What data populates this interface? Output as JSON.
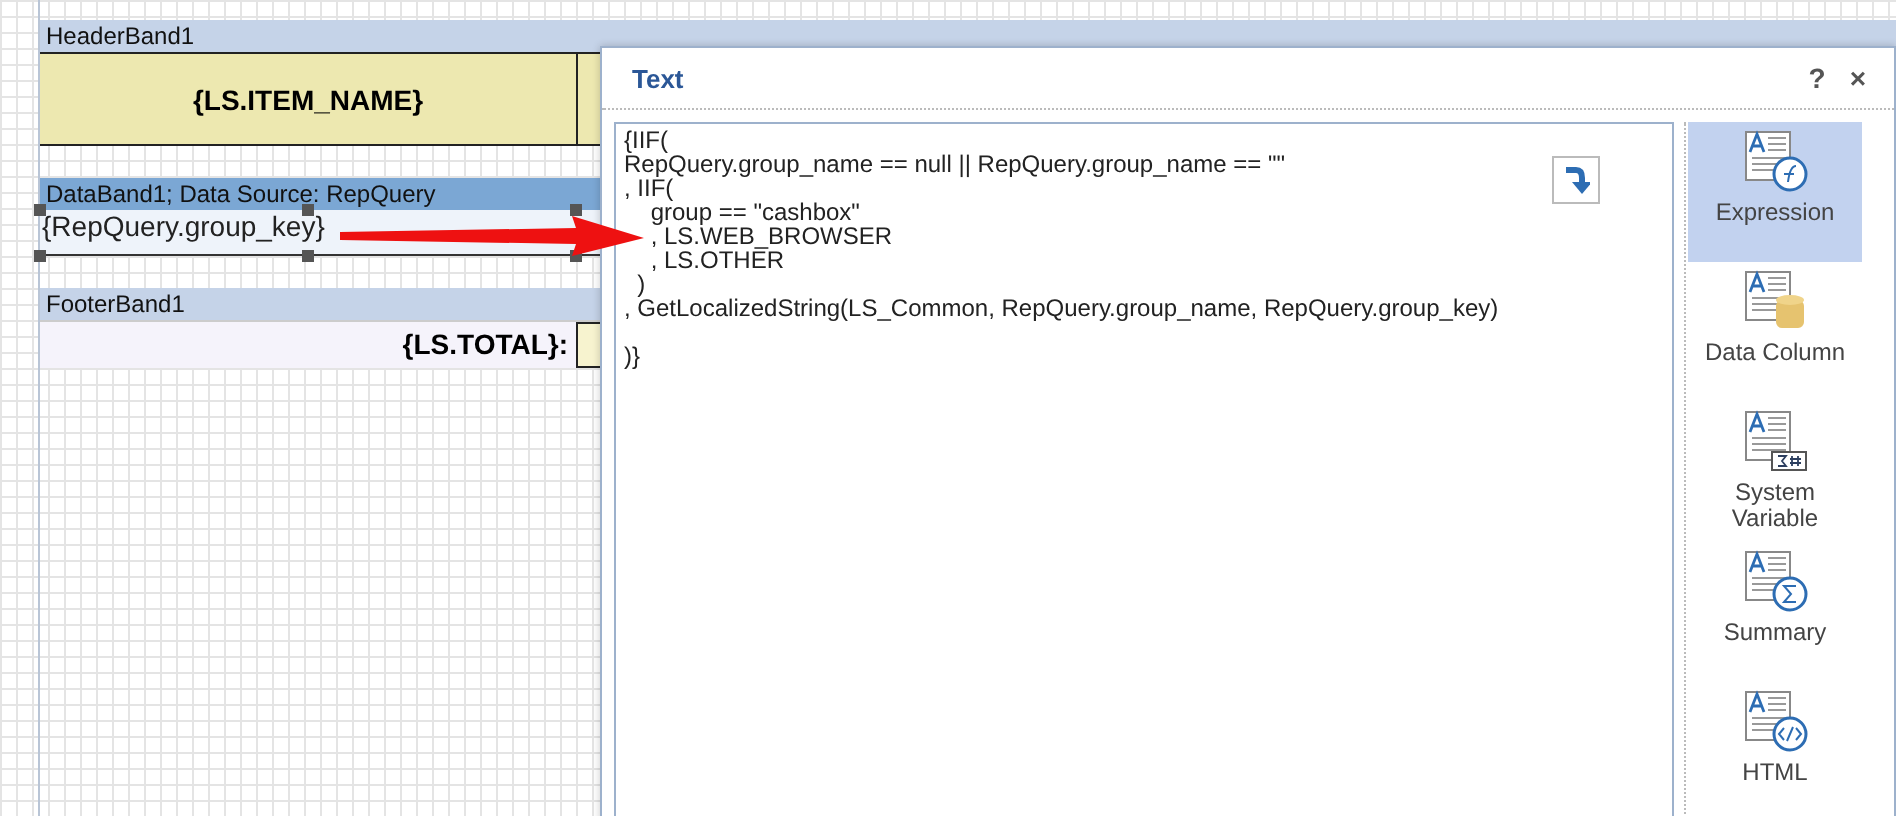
{
  "report": {
    "header_band": {
      "title": "HeaderBand1",
      "cell": "{LS.ITEM_NAME}"
    },
    "data_band": {
      "title": "DataBand1; Data Source: RepQuery",
      "cell": "{RepQuery.group_key}"
    },
    "footer_band": {
      "title": "FooterBand1",
      "cell": "{LS.TOTAL}:"
    }
  },
  "dialog": {
    "title": "Text",
    "help": "?",
    "close": "×",
    "expression": "{IIF(\nRepQuery.group_name == null || RepQuery.group_name == \"\"\n, IIF(\n    group == \"cashbox\"\n    , LS.WEB_BROWSER\n    , LS.OTHER\n  )\n, GetLocalizedString(LS_Common, RepQuery.group_name, RepQuery.group_key)\n\n)}",
    "tabs": [
      {
        "kind": "expression",
        "label": "Expression",
        "selected": true
      },
      {
        "kind": "column",
        "label": "Data Column",
        "selected": false
      },
      {
        "kind": "variable",
        "label": "System Variable",
        "selected": false
      },
      {
        "kind": "summary",
        "label": "Summary",
        "selected": false
      },
      {
        "kind": "html",
        "label": "HTML",
        "selected": false
      }
    ]
  }
}
